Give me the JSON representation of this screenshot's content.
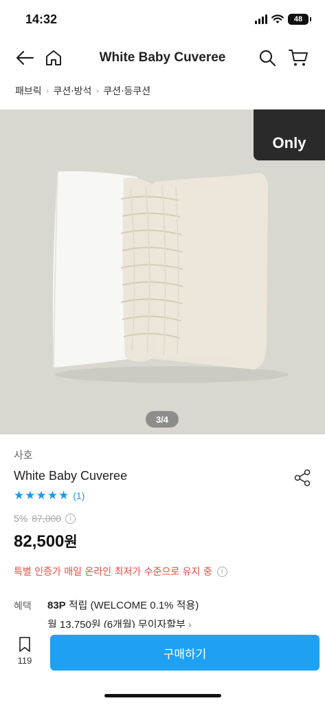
{
  "status": {
    "time": "14:32",
    "battery": "48"
  },
  "header": {
    "title": "White Baby Cuveree"
  },
  "breadcrumb": [
    "패브릭",
    "쿠션·방석",
    "쿠션·등쿠션"
  ],
  "image": {
    "badge": "Only",
    "page_indicator": "3/4"
  },
  "product": {
    "brand": "사호",
    "name": "White Baby Cuveree",
    "rating_stars": 5,
    "review_count": "(1)",
    "discount": "5%",
    "original_price": "87,000",
    "price": "82,500",
    "price_unit": "원",
    "notice": "특별 인증가 매일 온라인 최저가 수준으로 유지 중"
  },
  "benefit": {
    "label": "혜택",
    "points": "83P",
    "points_desc": " 적립 (WELCOME 0.1% 적용)",
    "installment": "월 13,750원 (6개월) 무이자할부"
  },
  "bottom": {
    "bookmark_count": "119",
    "buy_label": "구매하기"
  },
  "colors": {
    "accent": "#1ea1f2",
    "star": "#2196e8",
    "notice": "#e84a3d"
  }
}
